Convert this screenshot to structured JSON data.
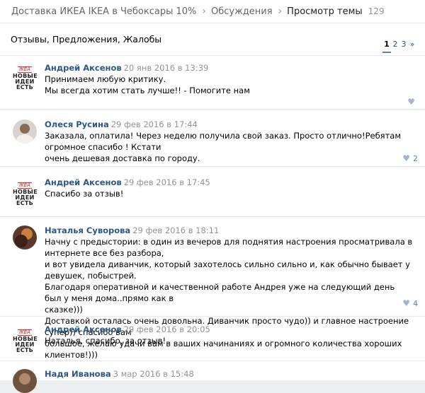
{
  "breadcrumb": {
    "group": "Доставка ИКЕА IKEA в Чебоксары 10%",
    "section": "Обсуждения",
    "current": "Просмотр темы",
    "count": "129"
  },
  "topic_title": "Отзывы, Предложения, Жалобы",
  "pager": [
    "1",
    "2",
    "3",
    "»"
  ],
  "ikea_avatar": {
    "logo": "IKEA",
    "text": "НОВЫЕ ИДЕИ ЕСТЬ"
  },
  "posts": [
    {
      "author": "Андрей Аксенов",
      "date": "20 янв 2016 в 13:39",
      "lines": [
        "Принимаем любую критику.",
        "Мы всегда хотим стать лучше!! - Помогите нам"
      ],
      "likes": ""
    },
    {
      "author": "Олеся Русина",
      "date": "29 фев 2016 в 17:44",
      "lines": [
        "Заказала, оплатила! Через неделю получила свой заказ. Просто отлично!Ребятам огромное спасибо ! Кстати",
        "очень дешевая доставка по городу."
      ],
      "likes": "2"
    },
    {
      "author": "Андрей Аксенов",
      "date": "29 фев 2016 в 17:45",
      "lines": [
        "Спасибо за отзыв!"
      ],
      "likes": ""
    },
    {
      "author": "Наталья Суворова",
      "date": "29 фев 2016 в 18:11",
      "lines": [
        "Начну с предыстории: в один из вечеров для поднятия настроения просматривала в интернете все без разбора,",
        "и вот увидела диванчик, который захотелось сильно сильно и, как обычно бывает у девушек, побыстрей.",
        "Благодаря оперативной и качественной работе Андрея уже на следующий день был у меня дома..прямо как в",
        "сказке)))",
        "Доставкой осталась очень довольна. Диванчик просто чудо)) и главное настроение супер)) спасибо вам",
        "большое, желаю удачи вам в ваших начинаниях и огромного количества хороших клиентов!)))"
      ],
      "likes": "4"
    },
    {
      "author": "Андрей Аксенов",
      "date": "29 фев 2016 в 20:05",
      "lines": [
        "Наталья, спасибо, за отзыв!"
      ],
      "likes": ""
    },
    {
      "author": "Надя Иванова",
      "date": "3 мар 2016 в 15:48",
      "lines": [],
      "likes": ""
    }
  ],
  "colors": {
    "link": "#2a5885",
    "muted": "#939393",
    "like": "#a2b5cc",
    "border": "#e7e8ec"
  }
}
